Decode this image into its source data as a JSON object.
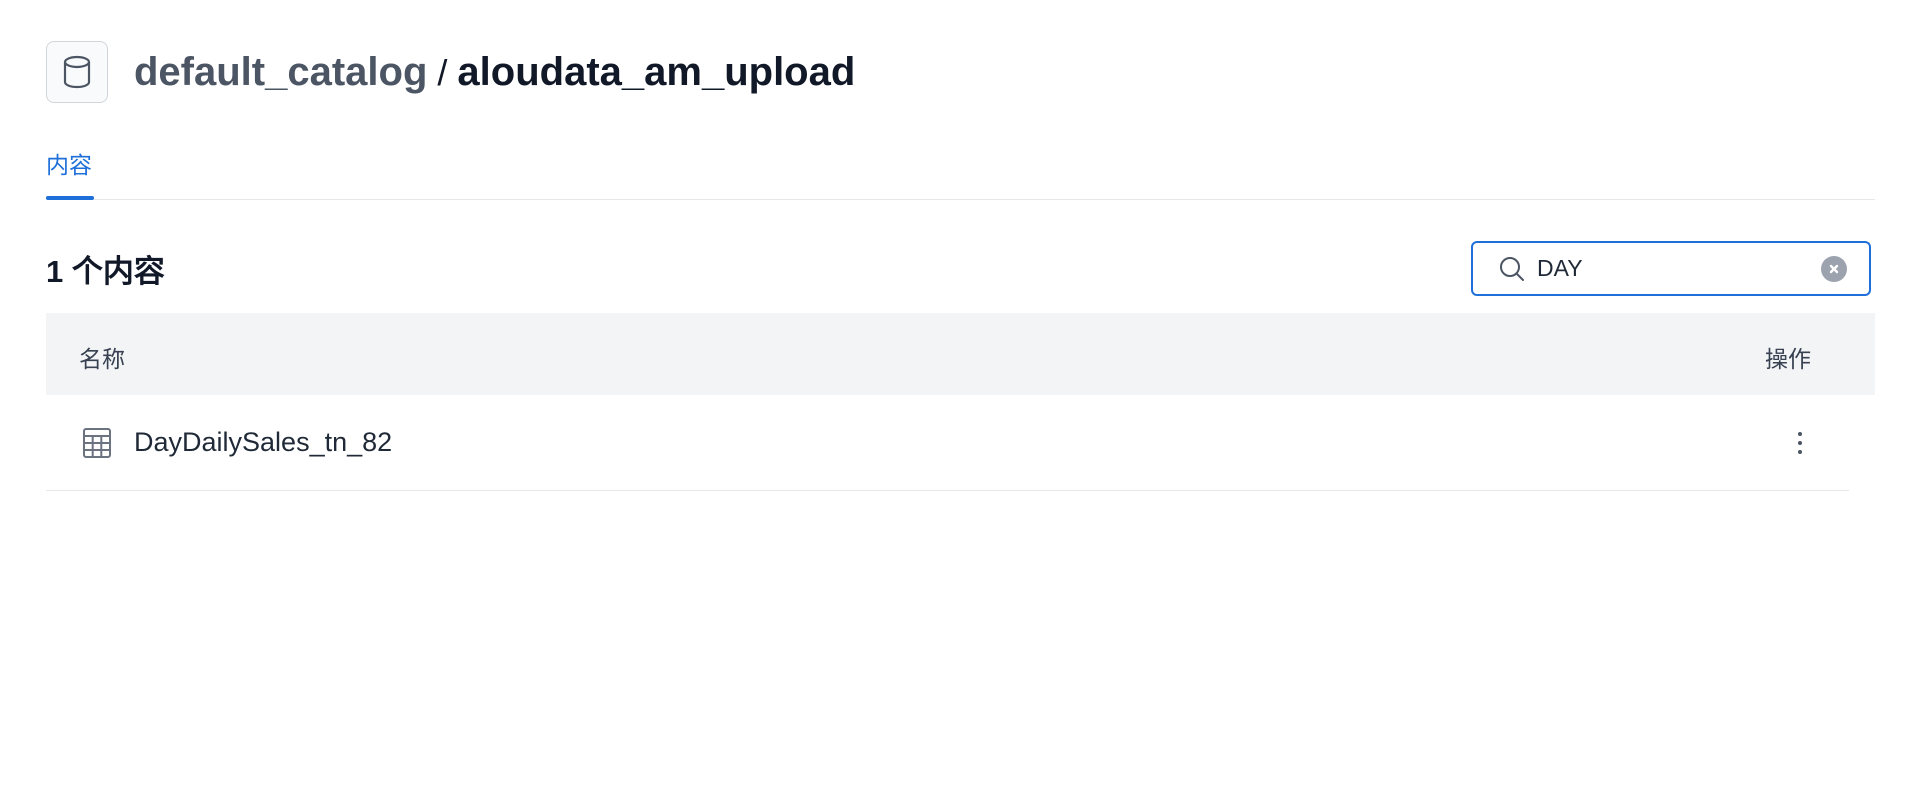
{
  "header": {
    "catalog": "default_catalog",
    "separator": "/",
    "schema": "aloudata_am_upload",
    "icon": "database-icon"
  },
  "tabs": [
    {
      "label": "内容",
      "active": true
    }
  ],
  "content": {
    "count_title": "1 个内容"
  },
  "search": {
    "value": "DAY",
    "placeholder": "",
    "icon": "search-icon",
    "clear_icon": "clear-icon"
  },
  "table": {
    "columns": {
      "name": "名称",
      "actions": "操作"
    },
    "rows": [
      {
        "name": "DayDailySales_tn_82",
        "icon": "table-icon",
        "action_icon": "more-vertical-icon"
      }
    ]
  },
  "colors": {
    "accent": "#1e6fd9",
    "header_bg": "#f3f4f6",
    "text": "#1f2937",
    "muted": "#4b5563"
  }
}
